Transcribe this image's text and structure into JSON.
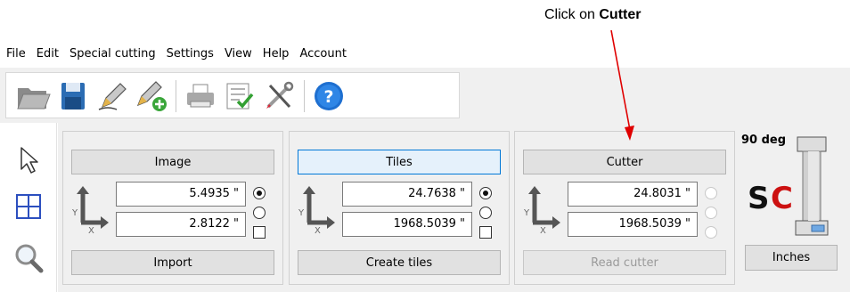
{
  "annotation": {
    "prefix": "Click on ",
    "target": "Cutter"
  },
  "menu": [
    "File",
    "Edit",
    "Special cutting",
    "Settings",
    "View",
    "Help",
    "Account"
  ],
  "toolbar": {
    "icons": [
      "open-folder",
      "save",
      "pen-edit",
      "pen-add",
      "print",
      "checklist",
      "tools",
      "help"
    ]
  },
  "tools": [
    "pointer-arrow",
    "grid-select",
    "magnifier"
  ],
  "groups": {
    "image": {
      "button": "Image",
      "field1": "5.4935 \"",
      "field2": "2.8122 \"",
      "action": "Import",
      "radio1_selected": true
    },
    "tiles": {
      "button": "Tiles",
      "field1": "24.7638 \"",
      "field2": "1968.5039 \"",
      "action": "Create tiles",
      "radio1_selected": true
    },
    "cutter": {
      "button": "Cutter",
      "field1": "24.8031 \"",
      "field2": "1968.5039 \"",
      "action": "Read cutter"
    }
  },
  "axis": {
    "y": "Y",
    "x": "X"
  },
  "orientation": "90 deg",
  "units_button": "Inches",
  "logo_text": "SC",
  "colors": {
    "accent_blue": "#0078d7",
    "arrow_red": "#e00000",
    "logo_red": "#cc1111"
  }
}
